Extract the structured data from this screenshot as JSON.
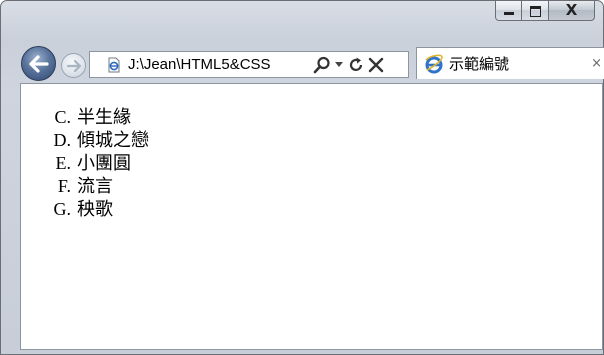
{
  "window": {
    "caption_buttons": [
      "minimize",
      "maximize",
      "close"
    ],
    "close_glyph": "X"
  },
  "navigation": {
    "back_icon": "back-arrow-icon",
    "forward_icon": "forward-arrow-icon",
    "address": "J:\\Jean\\HTML5&CSS",
    "address_icons": [
      "page-icon",
      "search-icon",
      "dropdown-icon",
      "refresh-icon",
      "stop-icon"
    ]
  },
  "tab": {
    "title": "示範編號",
    "icon": "ie-icon",
    "close_glyph": "×"
  },
  "list": {
    "items": [
      {
        "marker": "C.",
        "label": "半生緣"
      },
      {
        "marker": "D.",
        "label": "傾城之戀"
      },
      {
        "marker": "E.",
        "label": "小團圓"
      },
      {
        "marker": "F.",
        "label": "流言"
      },
      {
        "marker": "G.",
        "label": "秧歌"
      }
    ]
  },
  "colors": {
    "accent": "#59739b",
    "frame": "#c9d0da"
  }
}
